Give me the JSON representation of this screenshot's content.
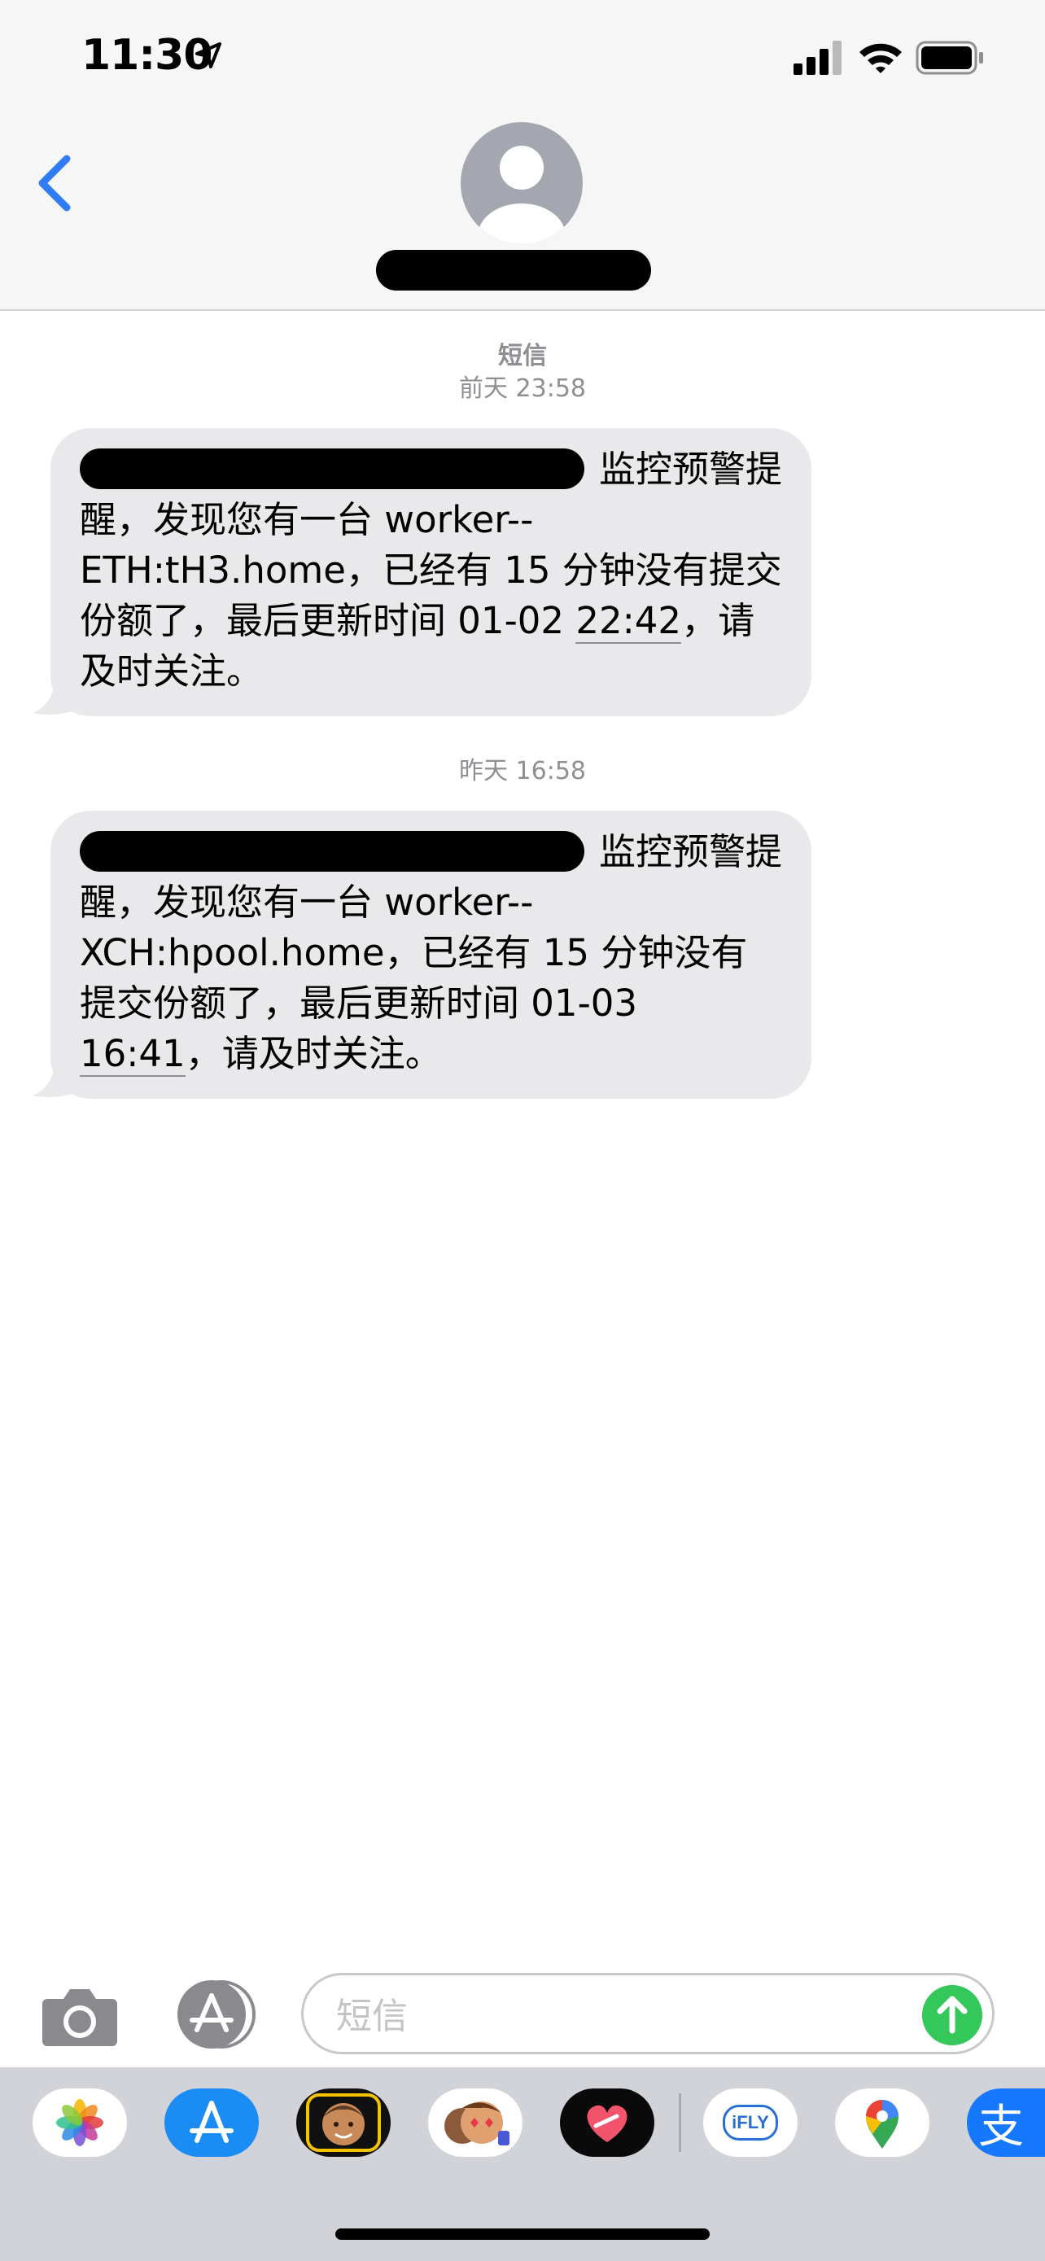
{
  "status_bar": {
    "time": "11:30"
  },
  "header": {
    "back_label": "back"
  },
  "thread": [
    {
      "timestamp_label": "短信",
      "timestamp_time": "前天 23:58",
      "message": {
        "text_before": "监控预警提醒，发现您有一台 worker--ETH:tH3.home，已经有 15 分钟没有提交份额了，最后更新时间 01-02 ",
        "text_link": "22:42",
        "text_after": "，请及时关注。"
      }
    },
    {
      "timestamp_time": "昨天 16:58",
      "message": {
        "text_before": "监控预警提醒，发现您有一台 worker--XCH:hpool.home，已经有 15 分钟没有提交份额了，最后更新时间 01-03 ",
        "text_link": "16:41",
        "text_after": "，请及时关注。"
      }
    }
  ],
  "composer": {
    "placeholder": "短信"
  },
  "app_tray": {
    "apps": [
      {
        "name": "photos-icon",
        "color": "#ffffff"
      },
      {
        "name": "app-store-icon",
        "color": "#1a8cf4"
      },
      {
        "name": "memoji-icon",
        "color": "#111111"
      },
      {
        "name": "animoji-stickers-icon",
        "color": "#ffffff"
      },
      {
        "name": "digital-touch-icon",
        "color": "#0a0a0a"
      },
      {
        "name": "ifly-icon",
        "color": "#ffffff"
      },
      {
        "name": "google-maps-icon",
        "color": "#ffffff"
      },
      {
        "name": "alipay-icon",
        "color": "#1677ff"
      }
    ],
    "ifly_text": "iFLY",
    "alipay_text": "支"
  },
  "colors": {
    "bubble": "#e9e9eb",
    "accent": "#2f7cf6",
    "send": "#34c759"
  }
}
